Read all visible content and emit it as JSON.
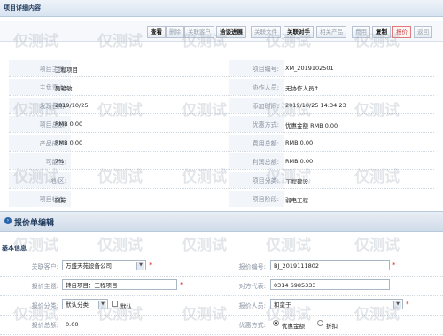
{
  "titlebar": {
    "title": "项目详细内容"
  },
  "toolbar": {
    "buttons": [
      {
        "label": "查看"
      },
      {
        "label": "删除"
      },
      {
        "label": "关联客户"
      },
      {
        "label": "洽谈进展"
      },
      {
        "label": "关联文件"
      },
      {
        "label": "关联对手"
      },
      {
        "label": "相关产品"
      },
      {
        "label": "费用"
      },
      {
        "label": "复制"
      },
      {
        "label": "报价"
      },
      {
        "label": "返回"
      }
    ]
  },
  "detail": {
    "rows": [
      {
        "l1": "项目主题:",
        "v1": "工程项目",
        "l2": "项目编号:",
        "v2": "XM_2019102501"
      },
      {
        "l1": "主负责人:",
        "v1": "吴艳敏",
        "l2": "协作人员:",
        "v2": "无协作人员↑"
      },
      {
        "l1": "发现日期:",
        "v1": "2019/10/25",
        "l2": "添加时间:",
        "v2": "2019/10/25 14:34:23"
      },
      {
        "l1": "项目总额:",
        "v1": "RMB 0.00",
        "l2": "优惠方式:",
        "v2": "优惠金额 RMB 0.00"
      },
      {
        "l1": "产品成本:",
        "v1": "RMB 0.00",
        "l2": "费用总额:",
        "v2": "RMB 0.00"
      },
      {
        "l1": "可能性:",
        "v1": "7%",
        "l2": "利润总额:",
        "v2": "RMB 0.00"
      },
      {
        "l1": "地    区:",
        "v1": "",
        "l2": "项目分类:",
        "v2": "工程建设"
      },
      {
        "l1": "项目状态:",
        "v1": "跟踪",
        "l2": "项目阶段:",
        "v2": "弱电工程"
      }
    ]
  },
  "section": {
    "title": "报价单编辑"
  },
  "basic_info": "基本信息",
  "form": {
    "customer_label": "关联客户:",
    "customer_value": "万盛天苑设备公司",
    "quote_no_label": "报价编号:",
    "quote_no_value": "BJ_2019111802",
    "subject_label": "报价主题:",
    "subject_value": "转自项目：工程项目",
    "contact_label": "对方代表:",
    "contact_value": "0314 6985333",
    "category_label": "报价分类:",
    "category_value": "默认分类",
    "category_check_label": "默认",
    "person_label": "报价人员:",
    "person_value": "和蛮于",
    "total_label": "报价总额:",
    "total_value": "0.00",
    "discount_label": "优惠方式:",
    "discount_opt1": "优惠金额",
    "discount_opt2": "折扣"
  },
  "watermark": "仅测试"
}
